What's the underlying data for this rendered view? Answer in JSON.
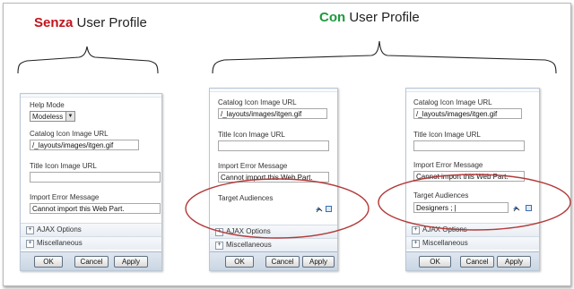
{
  "headings": {
    "left": {
      "strong": "Senza",
      "rest": " User Profile"
    },
    "right": {
      "strong": "Con",
      "rest": " User Profile"
    }
  },
  "colors": {
    "senza": "#c0151c",
    "con": "#1c9a3c",
    "ellipse": "#b33a3a"
  },
  "panel_left": {
    "help_mode_label": "Help Mode",
    "help_mode_value": "Modeless",
    "catalog_label": "Catalog Icon Image URL",
    "catalog_value": "/_layouts/images/itgen.gif",
    "title_icon_label": "Title Icon Image URL",
    "title_icon_value": "",
    "import_error_label": "Import Error Message",
    "import_error_value": "Cannot import this Web Part.",
    "ajax_label": "AJAX Options",
    "misc_label": "Miscellaneous",
    "ok": "OK",
    "cancel": "Cancel",
    "apply": "Apply"
  },
  "panel_mid": {
    "catalog_label": "Catalog Icon Image URL",
    "catalog_value": "/_layouts/images/itgen.gif",
    "title_icon_label": "Title Icon Image URL",
    "title_icon_value": "",
    "import_error_label": "Import Error Message",
    "import_error_value": "Cannot import this Web Part.",
    "target_label": "Target Audiences",
    "ajax_label": "AJAX Options",
    "misc_label": "Miscellaneous",
    "ok": "OK",
    "cancel": "Cancel",
    "apply": "Apply"
  },
  "panel_right": {
    "catalog_label": "Catalog Icon Image URL",
    "catalog_value": "/_layouts/images/itgen.gif",
    "title_icon_label": "Title Icon Image URL",
    "title_icon_value": "",
    "import_error_label": "Import Error Message",
    "import_error_value": "Cannot import this Web Part.",
    "target_label": "Target Audiences",
    "target_value": "Designers ; |",
    "ajax_label": "AJAX Options",
    "misc_label": "Miscellaneous",
    "ok": "OK",
    "cancel": "Cancel",
    "apply": "Apply"
  },
  "icons": [
    "check-names-icon",
    "browse-book-icon",
    "expand-plus-icon",
    "dropdown-arrow-icon"
  ]
}
